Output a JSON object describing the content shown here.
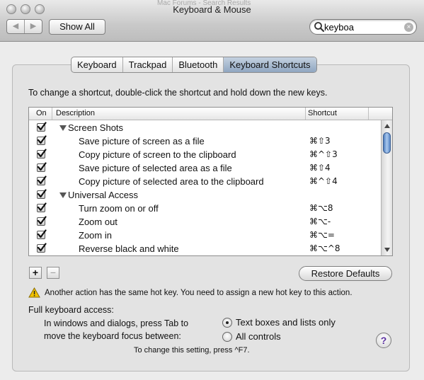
{
  "window": {
    "title": "Keyboard & Mouse",
    "ghost_text": "Mac Forums - Search Results"
  },
  "toolbar": {
    "back_glyph": "◀",
    "forward_glyph": "▶",
    "show_all_label": "Show All",
    "search_value": "keyboa",
    "search_clear_glyph": "×"
  },
  "tabs": [
    {
      "label": "Keyboard",
      "active": false
    },
    {
      "label": "Trackpad",
      "active": false
    },
    {
      "label": "Bluetooth",
      "active": false
    },
    {
      "label": "Keyboard Shortcuts",
      "active": true
    }
  ],
  "instructions": "To change a shortcut, double-click the shortcut and hold down the new keys.",
  "table": {
    "headers": {
      "on": "On",
      "description": "Description",
      "shortcut": "Shortcut"
    },
    "rows": [
      {
        "on": true,
        "group": true,
        "description": "Screen Shots",
        "shortcut": ""
      },
      {
        "on": true,
        "group": false,
        "description": "Save picture of screen as a file",
        "shortcut": "⌘⇧3"
      },
      {
        "on": true,
        "group": false,
        "description": "Copy picture of screen to the clipboard",
        "shortcut": "⌘^⇧3"
      },
      {
        "on": true,
        "group": false,
        "description": "Save picture of selected area as a file",
        "shortcut": "⌘⇧4"
      },
      {
        "on": true,
        "group": false,
        "description": "Copy picture of selected area to the clipboard",
        "shortcut": "⌘^⇧4"
      },
      {
        "on": true,
        "group": true,
        "description": "Universal Access",
        "shortcut": ""
      },
      {
        "on": true,
        "group": false,
        "description": "Turn zoom on or off",
        "shortcut": "⌘⌥8"
      },
      {
        "on": true,
        "group": false,
        "description": "Zoom out",
        "shortcut": "⌘⌥-"
      },
      {
        "on": true,
        "group": false,
        "description": "Zoom in",
        "shortcut": "⌘⌥="
      },
      {
        "on": true,
        "group": false,
        "description": "Reverse black and white",
        "shortcut": "⌘⌥^8"
      }
    ]
  },
  "buttons": {
    "plus": "+",
    "minus": "−",
    "restore_defaults": "Restore Defaults",
    "help": "?"
  },
  "warning": "Another action has the same hot key. You need to assign a new hot key to this action.",
  "keyboard_access": {
    "label": "Full keyboard access:",
    "description_line1": "In windows and dialogs, press Tab to",
    "description_line2": "move the keyboard focus between:",
    "options": [
      {
        "label": "Text boxes and lists only",
        "selected": true
      },
      {
        "label": "All controls",
        "selected": false
      }
    ],
    "hint": "To change this setting, press ^F7."
  },
  "colors": {
    "selected_tab": "#8fa6c1",
    "scroll_thumb": "#5a89c8",
    "warning_yellow": "#f2c200",
    "help_mark": "#5a2fa0"
  }
}
